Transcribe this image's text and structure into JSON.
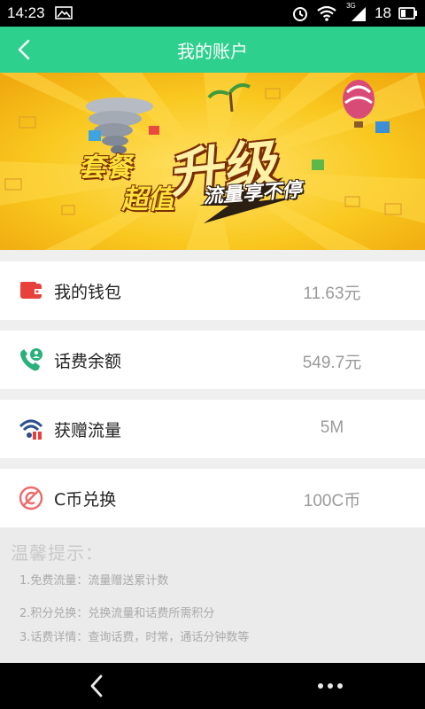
{
  "status": {
    "time": "14:23",
    "network": "3G",
    "battery": "18"
  },
  "header": {
    "title": "我的账户"
  },
  "banner": {
    "line1": "套餐",
    "line2": "超值",
    "big": "升级",
    "sub": "流量享不停"
  },
  "items": [
    {
      "label": "我的钱包",
      "value": "11.63元",
      "icon": "wallet-icon",
      "color": "#e8413c"
    },
    {
      "label": "话费余额",
      "value": "549.7元",
      "icon": "phone-balance-icon",
      "color": "#2ab07a"
    },
    {
      "label": "获赠流量",
      "value": "5M",
      "icon": "wifi-gift-icon",
      "color": "#2d4f8e"
    },
    {
      "label": "C币兑换",
      "value": "100C币",
      "icon": "coin-exchange-icon",
      "color": "#ef6a6a"
    }
  ],
  "tips": {
    "heading": "温馨提示：",
    "lines": [
      "1.免费流量：流量赠送累计数",
      "2.积分兑换：兑换流量和话费所需积分",
      "3.话费详情：查询话费，时常，通话分钟数等"
    ]
  },
  "colors": {
    "accent": "#2ed08d",
    "banner": "#f7c21b"
  }
}
